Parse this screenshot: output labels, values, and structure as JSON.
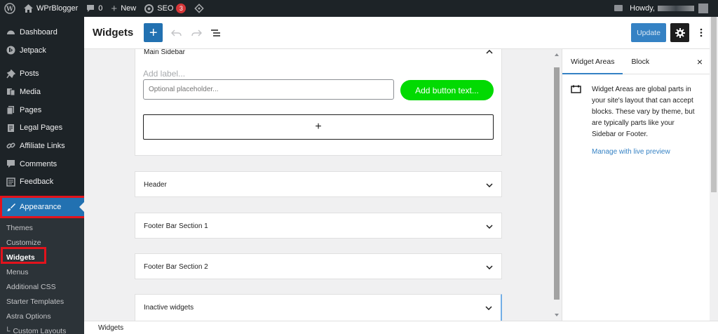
{
  "admin_bar": {
    "site_name": "WPrBlogger",
    "comments_count": "0",
    "new_label": "New",
    "seo_label": "SEO",
    "seo_badge": "3",
    "howdy": "Howdy,"
  },
  "sidebar": {
    "items": [
      {
        "label": "Dashboard",
        "icon": "dashboard-icon"
      },
      {
        "label": "Jetpack",
        "icon": "jetpack-icon"
      },
      {
        "label": "Posts",
        "icon": "pin-icon"
      },
      {
        "label": "Media",
        "icon": "media-icon"
      },
      {
        "label": "Pages",
        "icon": "pages-icon"
      },
      {
        "label": "Legal Pages",
        "icon": "legal-icon"
      },
      {
        "label": "Affiliate Links",
        "icon": "link-icon"
      },
      {
        "label": "Comments",
        "icon": "comment-icon"
      },
      {
        "label": "Feedback",
        "icon": "feedback-icon"
      },
      {
        "label": "Appearance",
        "icon": "brush-icon"
      }
    ],
    "submenu": [
      "Themes",
      "Customize",
      "Widgets",
      "Menus",
      "Additional CSS",
      "Starter Templates",
      "Astra Options",
      "Custom Layouts"
    ],
    "active_submenu": "Widgets"
  },
  "header": {
    "title": "Widgets",
    "update_label": "Update"
  },
  "areas": {
    "main": {
      "title": "Main Sidebar",
      "label_placeholder": "Add label...",
      "input_placeholder": "Optional placeholder...",
      "button_text": "Add button text...",
      "appender": "+"
    },
    "collapsed": [
      "Header",
      "Footer Bar Section 1",
      "Footer Bar Section 2",
      "Inactive widgets"
    ]
  },
  "panel": {
    "tabs": [
      "Widget Areas",
      "Block"
    ],
    "active_tab": "Widget Areas",
    "close": "×",
    "description": "Widget Areas are global parts in your site's layout that can accept blocks. These vary by theme, but are typically parts like your Sidebar or Footer.",
    "link": "Manage with live preview"
  },
  "footer": {
    "breadcrumb": "Widgets"
  },
  "colors": {
    "admin_bg": "#1d2327",
    "accent": "#2271b1",
    "highlight_box": "#e3131c",
    "button_green": "#02da02"
  }
}
